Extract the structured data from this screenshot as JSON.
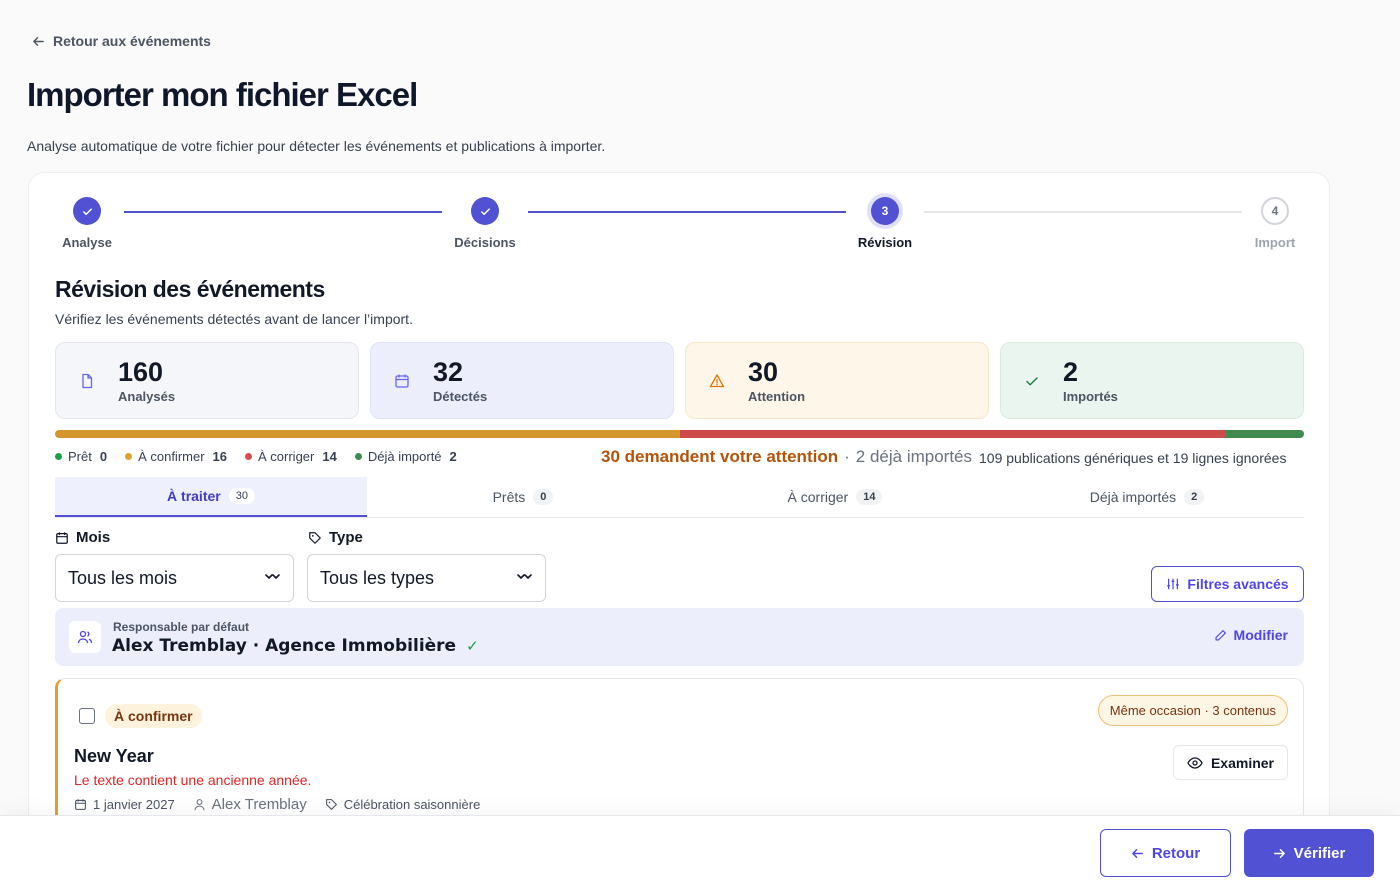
{
  "nav": {
    "back_label": "Retour aux événements"
  },
  "page": {
    "title": "Importer mon fichier Excel",
    "subtitle": "Analyse automatique de votre fichier pour détecter les événements et publications à importer."
  },
  "stepper": {
    "steps": [
      {
        "label": "Analyse",
        "state": "done"
      },
      {
        "label": "Décisions",
        "state": "done"
      },
      {
        "number": "3",
        "label": "Révision",
        "state": "active"
      },
      {
        "number": "4",
        "label": "Import",
        "state": "todo"
      }
    ]
  },
  "section": {
    "title": "Révision des événements",
    "subtitle": "Vérifiez les événements détectés avant de lancer l’import."
  },
  "stats": [
    {
      "value": "160",
      "label": "Analysés",
      "icon": "file-icon",
      "bg": "#f5f6fa",
      "border": "#e2e5ec",
      "icon_color": "#6366f1"
    },
    {
      "value": "32",
      "label": "Détectés",
      "icon": "calendar-icon",
      "bg": "#eceefb",
      "border": "#dfe2f7",
      "icon_color": "#6366f1"
    },
    {
      "value": "30",
      "label": "Attention",
      "icon": "warning-icon",
      "bg": "#fef6e9",
      "border": "#f8e6c6",
      "icon_color": "#d97706"
    },
    {
      "value": "2",
      "label": "Importés",
      "icon": "check-icon",
      "bg": "#eaf5ef",
      "border": "#d7ebdf",
      "icon_color": "#15803d"
    }
  ],
  "progress": {
    "total": 32,
    "segments": [
      {
        "name": "Prêt",
        "count": 0,
        "color": "#16a34a"
      },
      {
        "name": "À confirmer",
        "count": 16,
        "color": "#d4952d"
      },
      {
        "name": "À corriger",
        "count": 14,
        "color": "#cc4a4a"
      },
      {
        "name": "Déjà importé",
        "count": 2,
        "color": "#3f8a4f"
      }
    ]
  },
  "legend": [
    {
      "label": "Prêt",
      "count": "0",
      "color": "#16a34a"
    },
    {
      "label": "À confirmer",
      "count": "16",
      "color": "#e0a02c"
    },
    {
      "label": "À corriger",
      "count": "14",
      "color": "#dc4b4b"
    },
    {
      "label": "Déjà importé",
      "count": "2",
      "color": "#3f8a4f"
    }
  ],
  "summary": {
    "attention": "30 demandent votre attention",
    "separator": "·",
    "imported": "2 déjà importés",
    "ignored": "109 publications génériques et 19 lignes ignorées"
  },
  "tabs": [
    {
      "label": "À traiter",
      "count": "30"
    },
    {
      "label": "Prêts",
      "count": "0"
    },
    {
      "label": "À corriger",
      "count": "14"
    },
    {
      "label": "Déjà importés",
      "count": "2"
    }
  ],
  "filters": {
    "month_label": "Mois",
    "month_value": "Tous les mois",
    "type_label": "Type",
    "type_value": "Tous les types",
    "advanced_label": "Filtres avancés"
  },
  "responsible": {
    "label": "Responsable par défaut",
    "name": "Alex Tremblay · Agence Immobilière",
    "check": "✓",
    "edit_label": "Modifier"
  },
  "event": {
    "status": "À confirmer",
    "occasion": "Même occasion · 3 contenus",
    "title": "New Year",
    "warning": "Le texte contient une ancienne année.",
    "date": "1 janvier 2027",
    "author": "Alex Tremblay",
    "category": "Célébration saisonnière",
    "examine_label": "Examiner"
  },
  "footer": {
    "back_label": "Retour",
    "verify_label": "Vérifier"
  },
  "colors": {
    "accent": "#5151d3",
    "warning": "#b45309",
    "danger": "#dc2626"
  }
}
